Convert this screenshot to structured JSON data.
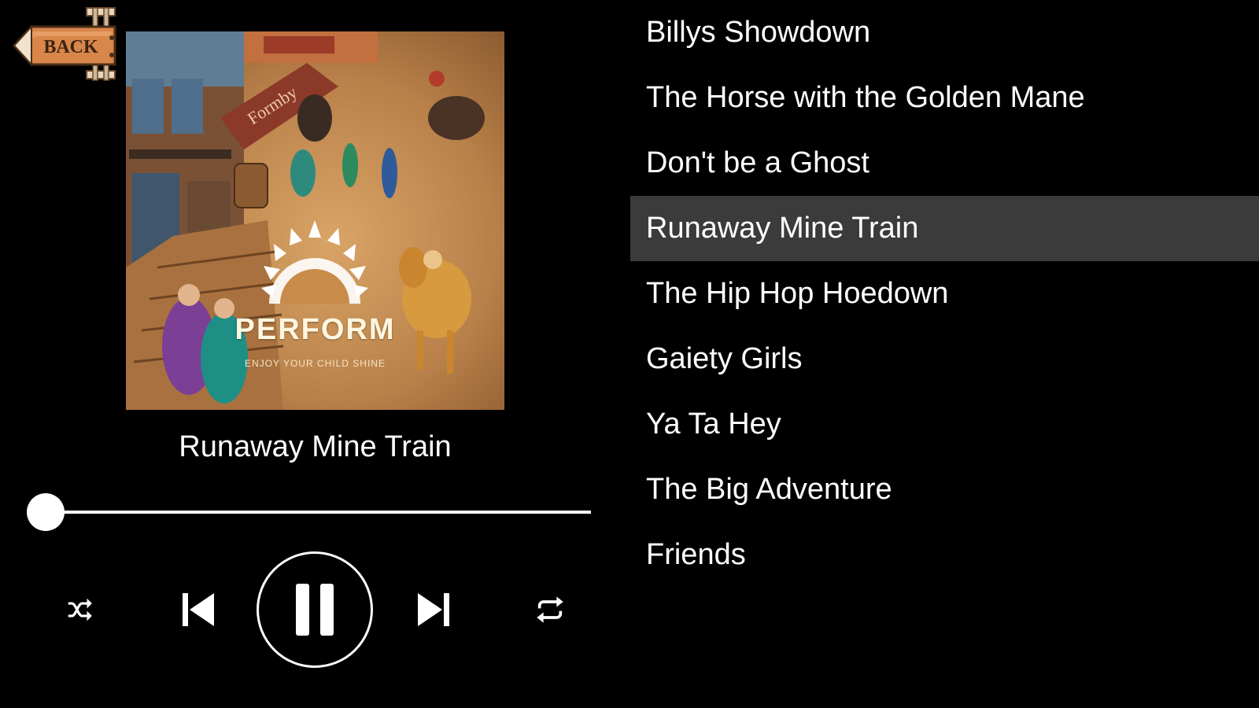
{
  "back_button": {
    "label": "BACK"
  },
  "album": {
    "brand": "PERFORM",
    "tagline": "ENJOY YOUR CHILD SHINE",
    "shop_sign": "Formby"
  },
  "now_playing": {
    "title": "Runaway Mine Train",
    "progress": 0.0,
    "state": "playing"
  },
  "controls": {
    "shuffle_icon": "shuffle-icon",
    "previous_icon": "skip-previous-icon",
    "play_pause_icon": "pause-icon",
    "next_icon": "skip-next-icon",
    "repeat_icon": "repeat-icon"
  },
  "playlist": {
    "active_index": 3,
    "tracks": [
      {
        "title": "Billys Showdown"
      },
      {
        "title": "The Horse with the Golden Mane"
      },
      {
        "title": "Don't be a Ghost"
      },
      {
        "title": "Runaway Mine Train"
      },
      {
        "title": "The Hip Hop Hoedown"
      },
      {
        "title": "Gaiety Girls"
      },
      {
        "title": "Ya Ta Hey"
      },
      {
        "title": "The Big Adventure"
      },
      {
        "title": "Friends"
      }
    ]
  },
  "colors": {
    "background": "#000000",
    "active_row": "#3b3b3b",
    "text": "#ffffff",
    "sign_wood": "#d9864a"
  }
}
